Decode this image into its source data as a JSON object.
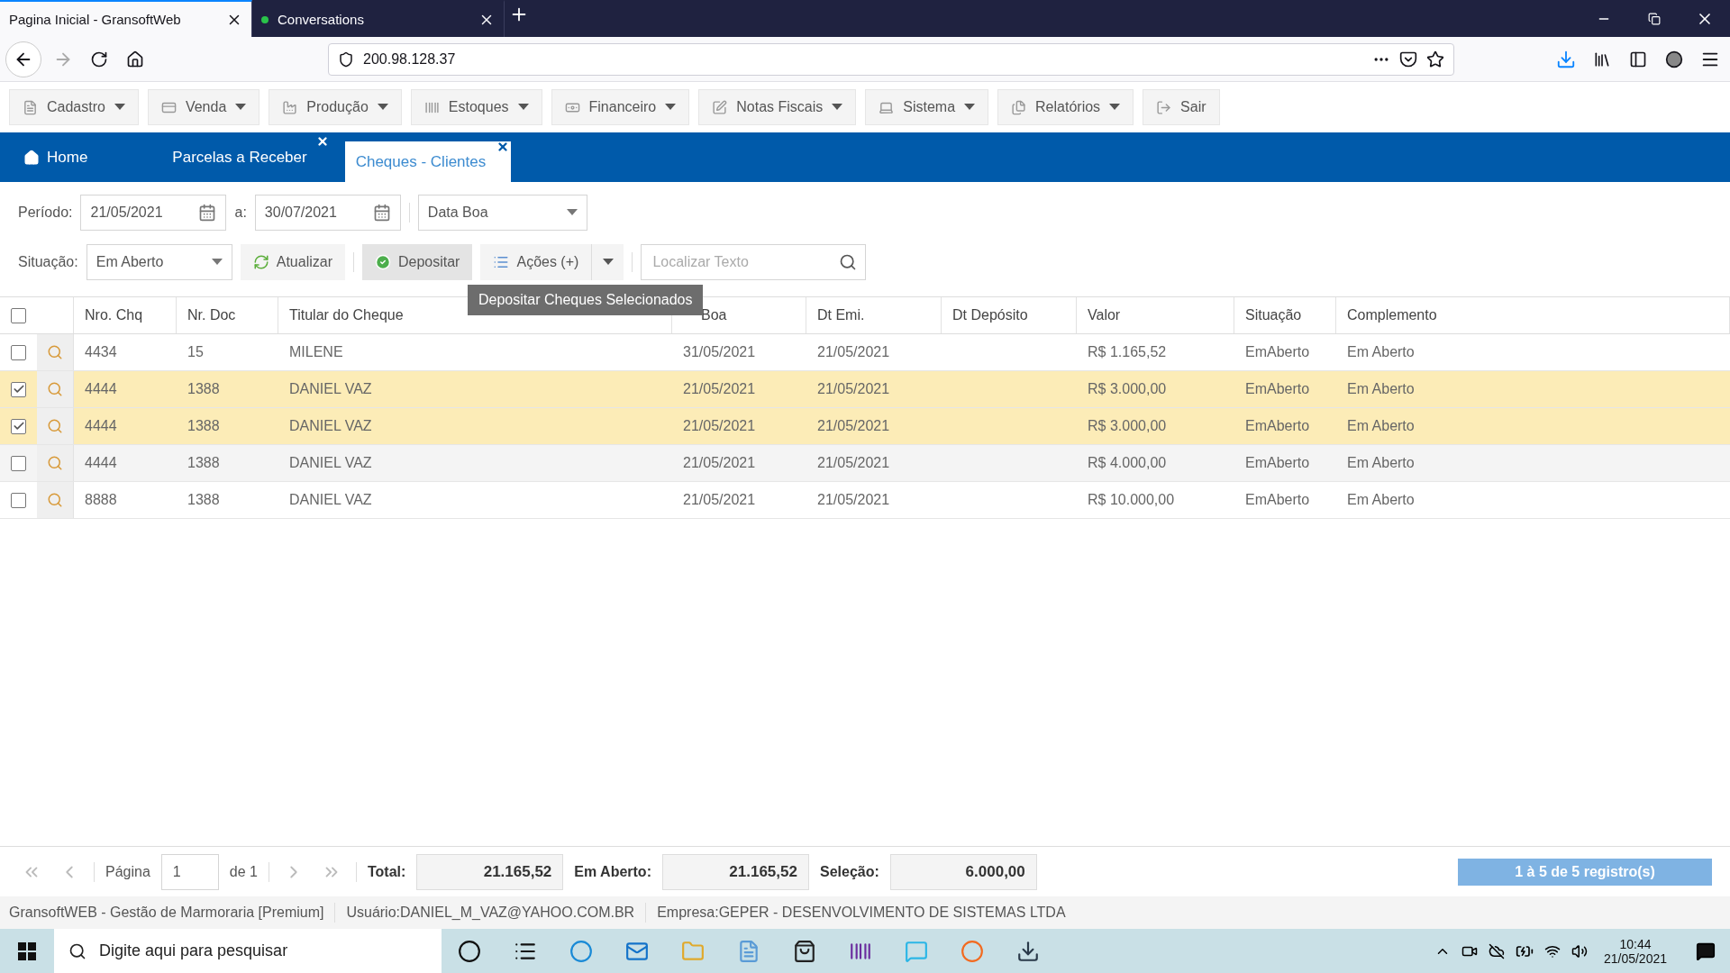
{
  "browser": {
    "tabs": [
      {
        "title": "Pagina Inicial - GransoftWeb",
        "selected": true
      },
      {
        "title": "Conversations",
        "selected": false
      }
    ],
    "url": "200.98.128.37"
  },
  "menu": [
    {
      "label": "Cadastro",
      "dropdown": true
    },
    {
      "label": "Venda",
      "dropdown": true
    },
    {
      "label": "Produção",
      "dropdown": true
    },
    {
      "label": "Estoques",
      "dropdown": true
    },
    {
      "label": "Financeiro",
      "dropdown": true
    },
    {
      "label": "Notas Fiscais",
      "dropdown": true
    },
    {
      "label": "Sistema",
      "dropdown": true
    },
    {
      "label": "Relatórios",
      "dropdown": true
    },
    {
      "label": "Sair",
      "dropdown": false
    }
  ],
  "app_tabs": [
    {
      "label": "Home",
      "selected": false,
      "closable": false
    },
    {
      "label": "Parcelas a Receber",
      "selected": false,
      "closable": true
    },
    {
      "label": "Cheques - Clientes",
      "selected": true,
      "closable": true
    }
  ],
  "filters": {
    "period_label": "Período:",
    "from": "21/05/2021",
    "to_label": "a:",
    "to": "30/07/2021",
    "date_type": "Data Boa",
    "situation_label": "Situação:",
    "situation": "Em Aberto",
    "refresh": "Atualizar",
    "deposit": "Depositar",
    "actions": "Ações (+)",
    "search_placeholder": "Localizar Texto"
  },
  "tooltip": "Depositar Cheques Selecionados",
  "table": {
    "all_checked": false,
    "columns": [
      "Nro. Chq",
      "Nr. Doc",
      "Titular do Cheque",
      "Boa",
      "Dt Emi.",
      "Dt Depósito",
      "Valor",
      "Situação",
      "Complemento"
    ],
    "rows": [
      {
        "selected": false,
        "cells": [
          "4434",
          "15",
          "MILENE",
          "31/05/2021",
          "21/05/2021",
          "",
          "R$ 1.165,52",
          "EmAberto",
          "Em Aberto"
        ]
      },
      {
        "selected": true,
        "cells": [
          "4444",
          "1388",
          "DANIEL VAZ",
          "21/05/2021",
          "21/05/2021",
          "",
          "R$ 3.000,00",
          "EmAberto",
          "Em Aberto"
        ]
      },
      {
        "selected": true,
        "cells": [
          "4444",
          "1388",
          "DANIEL VAZ",
          "21/05/2021",
          "21/05/2021",
          "",
          "R$ 3.000,00",
          "EmAberto",
          "Em Aberto"
        ]
      },
      {
        "selected": false,
        "cells": [
          "4444",
          "1388",
          "DANIEL VAZ",
          "21/05/2021",
          "21/05/2021",
          "",
          "R$ 4.000,00",
          "EmAberto",
          "Em Aberto"
        ]
      },
      {
        "selected": false,
        "cells": [
          "8888",
          "1388",
          "DANIEL VAZ",
          "21/05/2021",
          "21/05/2021",
          "",
          "R$ 10.000,00",
          "EmAberto",
          "Em Aberto"
        ]
      }
    ]
  },
  "pager": {
    "page_label": "Página",
    "page": "1",
    "of": "de 1",
    "totals": [
      {
        "label": "Total:",
        "value": "21.165,52"
      },
      {
        "label": "Em Aberto:",
        "value": "21.165,52"
      },
      {
        "label": "Seleção:",
        "value": "6.000,00"
      }
    ],
    "records": "1 à 5 de 5 registro(s)"
  },
  "status": [
    "GransoftWEB - Gestão de Marmoraria [Premium]",
    "Usuário:DANIEL_M_VAZ@YAHOO.COM.BR",
    "Empresa:GEPER - DESENVOLVIMENTO DE SISTEMAS LTDA"
  ],
  "taskbar": {
    "search_placeholder": "Digite aqui para pesquisar",
    "time": "10:44",
    "date": "21/05/2021"
  }
}
